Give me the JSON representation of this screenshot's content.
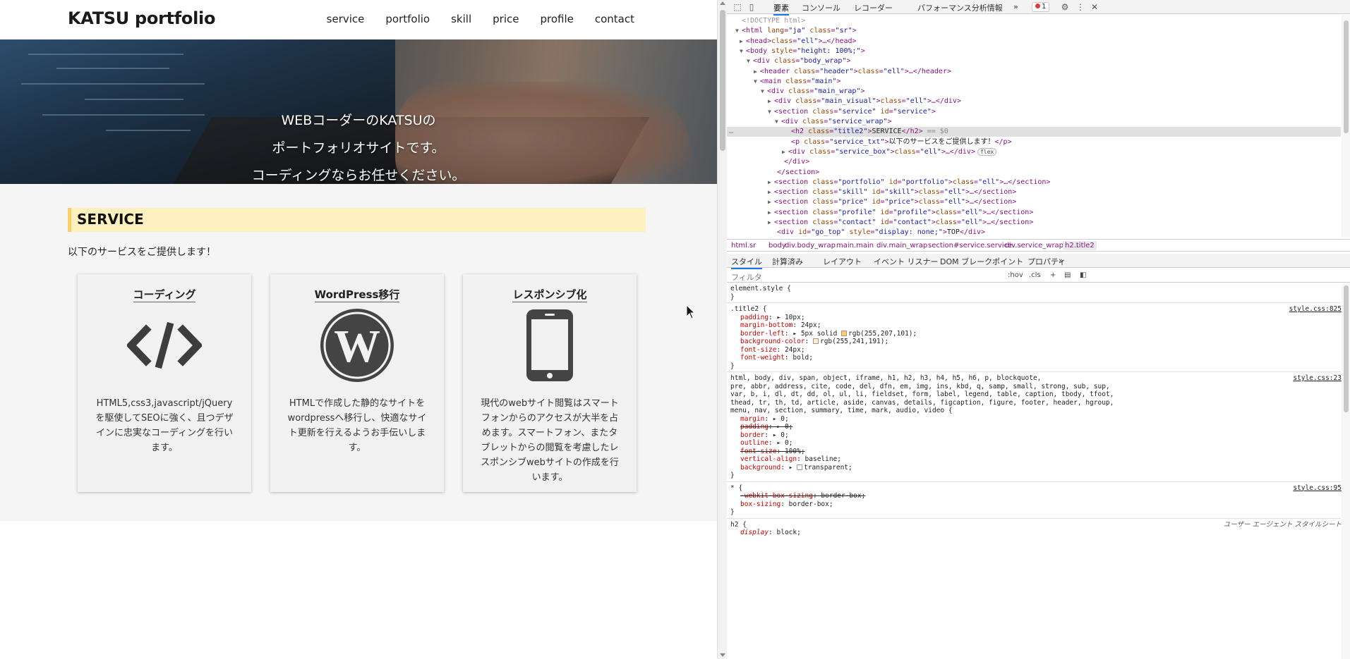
{
  "site": {
    "logo": "KATSU portfolio",
    "nav": [
      "service",
      "portfolio",
      "skill",
      "price",
      "profile",
      "contact"
    ],
    "hero_lines": [
      "WEBコーダーのKATSUの",
      "ポートフォリオサイトです。",
      "コーディングならお任せください。"
    ],
    "service_title": "SERVICE",
    "service_txt": "以下のサービスをご提供します！",
    "boxes": [
      {
        "title": "コーディング",
        "icon": "code-icon",
        "text": "HTML5,css3,javascript/jQueryを駆使してSEOに強く、且つデザインに忠実なコーディングを行います。"
      },
      {
        "title": "WordPress移行",
        "icon": "wordpress-icon",
        "text": "HTMLで作成した静的なサイトをwordpressへ移行し、快適なサイト更新を行えるようお手伝いします。"
      },
      {
        "title": "レスポンシブ化",
        "icon": "smartphone-icon",
        "text": "現代のwebサイト閲覧はスマートフォンからのアクセスが大半を占めます。スマートフォン、またタブレットからの閲覧を考慮したレスポンシブwebサイトの作成を行います。"
      }
    ],
    "colors": {
      "title_bg": "#fff1bf",
      "title_border": "#ffcf65"
    }
  },
  "devtools": {
    "tabs": [
      "要素",
      "コンソール",
      "レコーダー",
      "パフォーマンス分析情報"
    ],
    "more": "»",
    "error_count": "1",
    "dom": [
      {
        "t": "<!DOCTYPE html>"
      },
      {
        "t": "<html lang=\"ja\" class=\"sr\">"
      },
      {
        "t": "<head> … </head>"
      },
      {
        "t": "<body style=\"height: 100%;\">"
      },
      {
        "t": "<div class=\"body_wrap\">"
      },
      {
        "t": "<header class=\"header\"> … </header>"
      },
      {
        "t": "<main class=\"main\">"
      },
      {
        "t": "<div class=\"main_wrap\">"
      },
      {
        "t": "<div class=\"main_visual\"> … </div>"
      },
      {
        "t": "<section class=\"service\" id=\"service\">"
      },
      {
        "t": "<div class=\"service_wrap\">"
      },
      {
        "t": "<h2 class=\"title2\">SERVICE</h2> == $0"
      },
      {
        "t": "<p class=\"service_txt\">以下のサービスをご提供します！</p>"
      },
      {
        "t": "<div class=\"service_box\"> … </div>"
      },
      {
        "t": "</div>"
      },
      {
        "t": "</section>"
      },
      {
        "t": "<section class=\"portfolio\" id=\"portfolio\"> … </section>"
      },
      {
        "t": "<section class=\"skill\" id=\"skill\"> … </section>"
      },
      {
        "t": "<section class=\"price\" id=\"price\"> … </section>"
      },
      {
        "t": "<section class=\"profile\" id=\"profile\"> … </section>"
      },
      {
        "t": "<section class=\"contact\" id=\"contact\"> … </section>"
      },
      {
        "t": "<div id=\"go_top\" style=\"display: none;\">TOP</div>"
      }
    ],
    "flex_badge": "flex",
    "breadcrumbs": [
      "html.sr",
      "body",
      "div.body_wrap",
      "main.main",
      "div.main_wrap",
      "section#service.service",
      "div.service_wrap",
      "h2.title2"
    ],
    "subtabs": [
      "スタイル",
      "計算済み",
      "レイアウト",
      "イベント リスナー",
      "DOM ブレークポイント",
      "プロパティ",
      "»"
    ],
    "filter_placeholder": "フィルタ",
    "filter_right": [
      ":hov",
      ".cls",
      "+"
    ],
    "styles": {
      "element_style": "element.style {",
      "close": "}",
      "title2_selector": ".title2 {",
      "title2_src": "style.css:825",
      "title2_props": [
        [
          "padding",
          "▸ 10px;"
        ],
        [
          "margin-bottom",
          "24px;"
        ],
        [
          "border-left",
          "▸ 5px solid "
        ],
        [
          "background-color",
          ""
        ],
        [
          "font-size",
          "24px;"
        ],
        [
          "font-weight",
          "bold;"
        ]
      ],
      "border_color_text": "rgb(255,207,101);",
      "bg_color_text": "rgb(255,241,191);",
      "reset_selector": "html, body, div, span, object, iframe, h1, h2, h3, h4, h5, h6, p, blockquote,",
      "reset_selector2": "pre, abbr, address, cite, code, del, dfn, em, img, ins, kbd, q, samp, small, strong, sub, sup,",
      "reset_selector3": "var, b, i, dl, dt, dd, ol, ul, li, fieldset, form, label, legend, table, caption, tbody, tfoot,",
      "reset_selector4": "thead, tr, th, td, article, aside, canvas, details, figcaption, figure, footer, header, hgroup,",
      "reset_selector5": "menu, nav, section, summary, time, mark, audio, video {",
      "reset_src": "style.css:23",
      "reset_props": [
        [
          "margin",
          "▸ 0;",
          false
        ],
        [
          "padding",
          "▸ 0;",
          true
        ],
        [
          "border",
          "▸ 0;",
          false
        ],
        [
          "outline",
          "▸ 0;",
          false
        ],
        [
          "font-size",
          "100%;",
          true
        ],
        [
          "vertical-align",
          "baseline;",
          false
        ],
        [
          "background",
          "▸ transparent;",
          false
        ]
      ],
      "star_selector": "* {",
      "star_src": "style.css:95",
      "star_props": [
        [
          "-webkit-box-sizing",
          "border-box;",
          true
        ],
        [
          "box-sizing",
          "border-box;",
          false
        ]
      ],
      "h2_selector": "h2 {",
      "ua_label": "ユーザー エージェント スタイルシート",
      "h2_props": [
        [
          "display",
          "block;"
        ]
      ]
    }
  }
}
